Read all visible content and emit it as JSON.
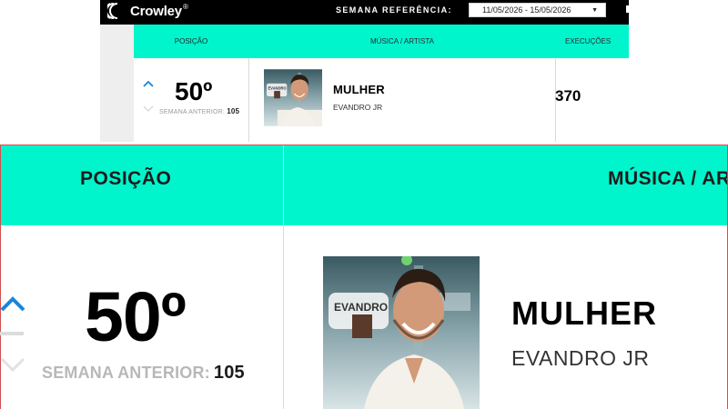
{
  "app": {
    "brand": "Crowley",
    "brand_mark": "®"
  },
  "week": {
    "label": "SEMANA REFERÊNCIA:",
    "selected": "11/05/2026 - 15/05/2026"
  },
  "table": {
    "columns": {
      "position": "POSIÇÃO",
      "track": "MÚSICA / ARTISTA",
      "plays": "EXECUÇÕES"
    },
    "zoom_columns": {
      "position": "POSIÇÃO",
      "track": "MÚSICA / AR"
    },
    "row": {
      "rank": "50º",
      "previous_label": "SEMANA ANTERIOR:",
      "previous_value": "105",
      "title": "MULHER",
      "artist": "EVANDRO JR",
      "plays": "370",
      "cover_text": "EVANDRO"
    }
  },
  "colors": {
    "header_bg": "#00f5cd",
    "top_bar": "#000000",
    "arrow_up": "#1a86d9",
    "arrow_down": "#dcdcdc",
    "crop_border": "#d24f4f"
  },
  "icons": {
    "logo": "crowley-waves-icon",
    "dropdown": "caret-down-icon",
    "trend_up": "chevron-up-icon",
    "trend_down": "chevron-down-icon"
  }
}
